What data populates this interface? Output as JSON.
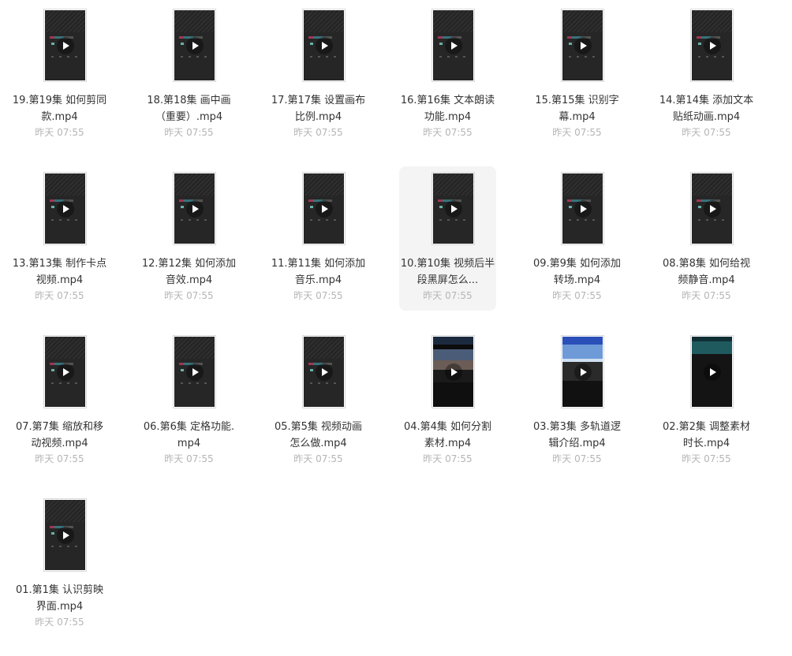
{
  "files": [
    {
      "name": "19.第19集 如何剪同款.mp4",
      "date": "昨天 07:55",
      "thumb": "dark-app"
    },
    {
      "name": "18.第18集 画中画（重要）.mp4",
      "date": "昨天 07:55",
      "thumb": "dark-app"
    },
    {
      "name": "17.第17集 设置画布比例.mp4",
      "date": "昨天 07:55",
      "thumb": "dark-app"
    },
    {
      "name": "16.第16集 文本朗读功能.mp4",
      "date": "昨天 07:55",
      "thumb": "dark-app"
    },
    {
      "name": "15.第15集 识别字幕.mp4",
      "date": "昨天 07:55",
      "thumb": "dark-app"
    },
    {
      "name": "14.第14集 添加文本贴纸动画.mp4",
      "date": "昨天 07:55",
      "thumb": "dark-app"
    },
    {
      "name": "13.第13集 制作卡点视频.mp4",
      "date": "昨天 07:55",
      "thumb": "dark-app"
    },
    {
      "name": "12.第12集 如何添加音效.mp4",
      "date": "昨天 07:55",
      "thumb": "dark-app"
    },
    {
      "name": "11.第11集 如何添加音乐.mp4",
      "date": "昨天 07:55",
      "thumb": "dark-app"
    },
    {
      "name": "10.第10集 视频后半段黑屏怎么...",
      "date": "昨天 07:55",
      "thumb": "dark-app",
      "hover": true
    },
    {
      "name": "09.第9集 如何添加转场.mp4",
      "date": "昨天 07:55",
      "thumb": "dark-app"
    },
    {
      "name": "08.第8集 如何给视频静音.mp4",
      "date": "昨天 07:55",
      "thumb": "dark-app"
    },
    {
      "name": "07.第7集 缩放和移动视频.mp4",
      "date": "昨天 07:55",
      "thumb": "dark-app"
    },
    {
      "name": "06.第6集 定格功能.mp4",
      "date": "昨天 07:55",
      "thumb": "dark-app"
    },
    {
      "name": "05.第5集 视频动画怎么做.mp4",
      "date": "昨天 07:55",
      "thumb": "dark-app"
    },
    {
      "name": "04.第4集 如何分割素材.mp4",
      "date": "昨天 07:55",
      "thumb": "scene-a"
    },
    {
      "name": "03.第3集 多轨道逻辑介绍.mp4",
      "date": "昨天 07:55",
      "thumb": "scene-b"
    },
    {
      "name": "02.第2集 调整素材时长.mp4",
      "date": "昨天 07:55",
      "thumb": "scene-c"
    },
    {
      "name": "01.第1集 认识剪映界面.mp4",
      "date": "昨天 07:55",
      "thumb": "dark-app"
    }
  ]
}
